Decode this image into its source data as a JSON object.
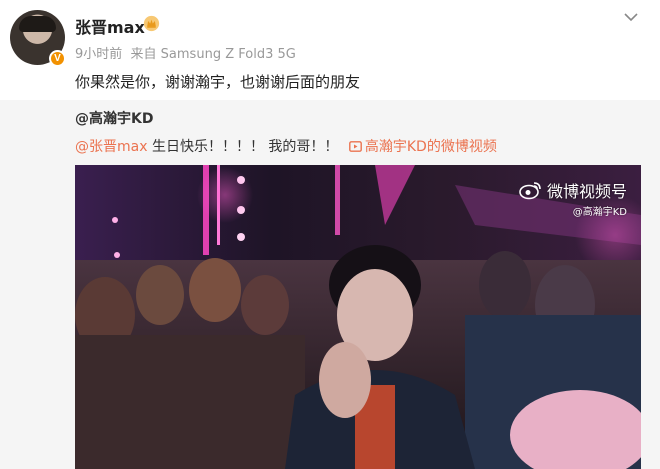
{
  "post": {
    "username": "张晋max",
    "time": "9小时前",
    "source": "来自 Samsung Z Fold3 5G",
    "text": "你果然是你，谢谢瀚宇，也谢谢后面的朋友"
  },
  "repost": {
    "author": "@高瀚宇KD",
    "mention": "@张晋max",
    "text": " 生日快乐！！！！ 我的哥！！",
    "video_link": "高瀚宇KD的微博视频"
  },
  "video": {
    "watermark_title": "微博视频号",
    "watermark_handle": "@高瀚宇KD"
  },
  "colors": {
    "verified_badge": "#f29100",
    "link": "#eb7350",
    "repost_bg": "#f5f5f5"
  },
  "icons": [
    "avatar",
    "verified-badge-icon",
    "crown-icon",
    "chevron-down-icon",
    "video-camera-icon",
    "weibo-logo-icon"
  ]
}
